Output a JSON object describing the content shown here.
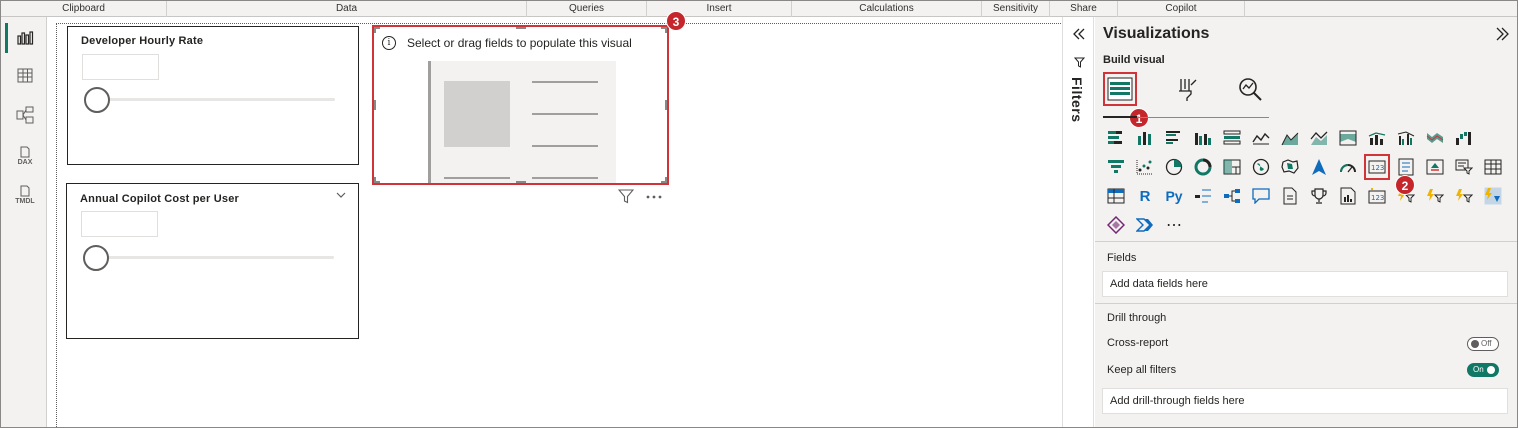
{
  "ribbon": {
    "groups": [
      "Clipboard",
      "Data",
      "Queries",
      "Insert",
      "Calculations",
      "Sensitivity",
      "Share",
      "Copilot"
    ]
  },
  "leftnav": {
    "items": [
      {
        "icon": "report-view-icon",
        "label": ""
      },
      {
        "icon": "table-view-icon",
        "label": ""
      },
      {
        "icon": "model-view-icon",
        "label": ""
      },
      {
        "icon": "dax-query-view-icon",
        "label": "DAX"
      },
      {
        "icon": "tmdl-view-icon",
        "label": "TMDL"
      }
    ]
  },
  "canvas": {
    "slicer1": {
      "title": "Developer Hourly Rate"
    },
    "slicer2": {
      "title": "Annual Copilot Cost per User"
    },
    "empty_visual": {
      "hint": "Select or drag fields to populate this visual"
    }
  },
  "steps": {
    "one": "1",
    "two": "2",
    "three": "3"
  },
  "filters": {
    "label": "Filters"
  },
  "viz": {
    "title": "Visualizations",
    "build_visual": "Build visual",
    "icon_more": "⋯",
    "fields_label": "Fields",
    "fields_placeholder": "Add data fields here",
    "drill_through": "Drill through",
    "cross_report": "Cross-report",
    "cross_report_state": "Off",
    "keep_all_filters": "Keep all filters",
    "keep_all_filters_state": "On",
    "drill_placeholder": "Add drill-through fields here"
  },
  "colors": {
    "accent_green": "#117865",
    "highlight_red": "#d13438",
    "badge_red": "#c4262b"
  }
}
